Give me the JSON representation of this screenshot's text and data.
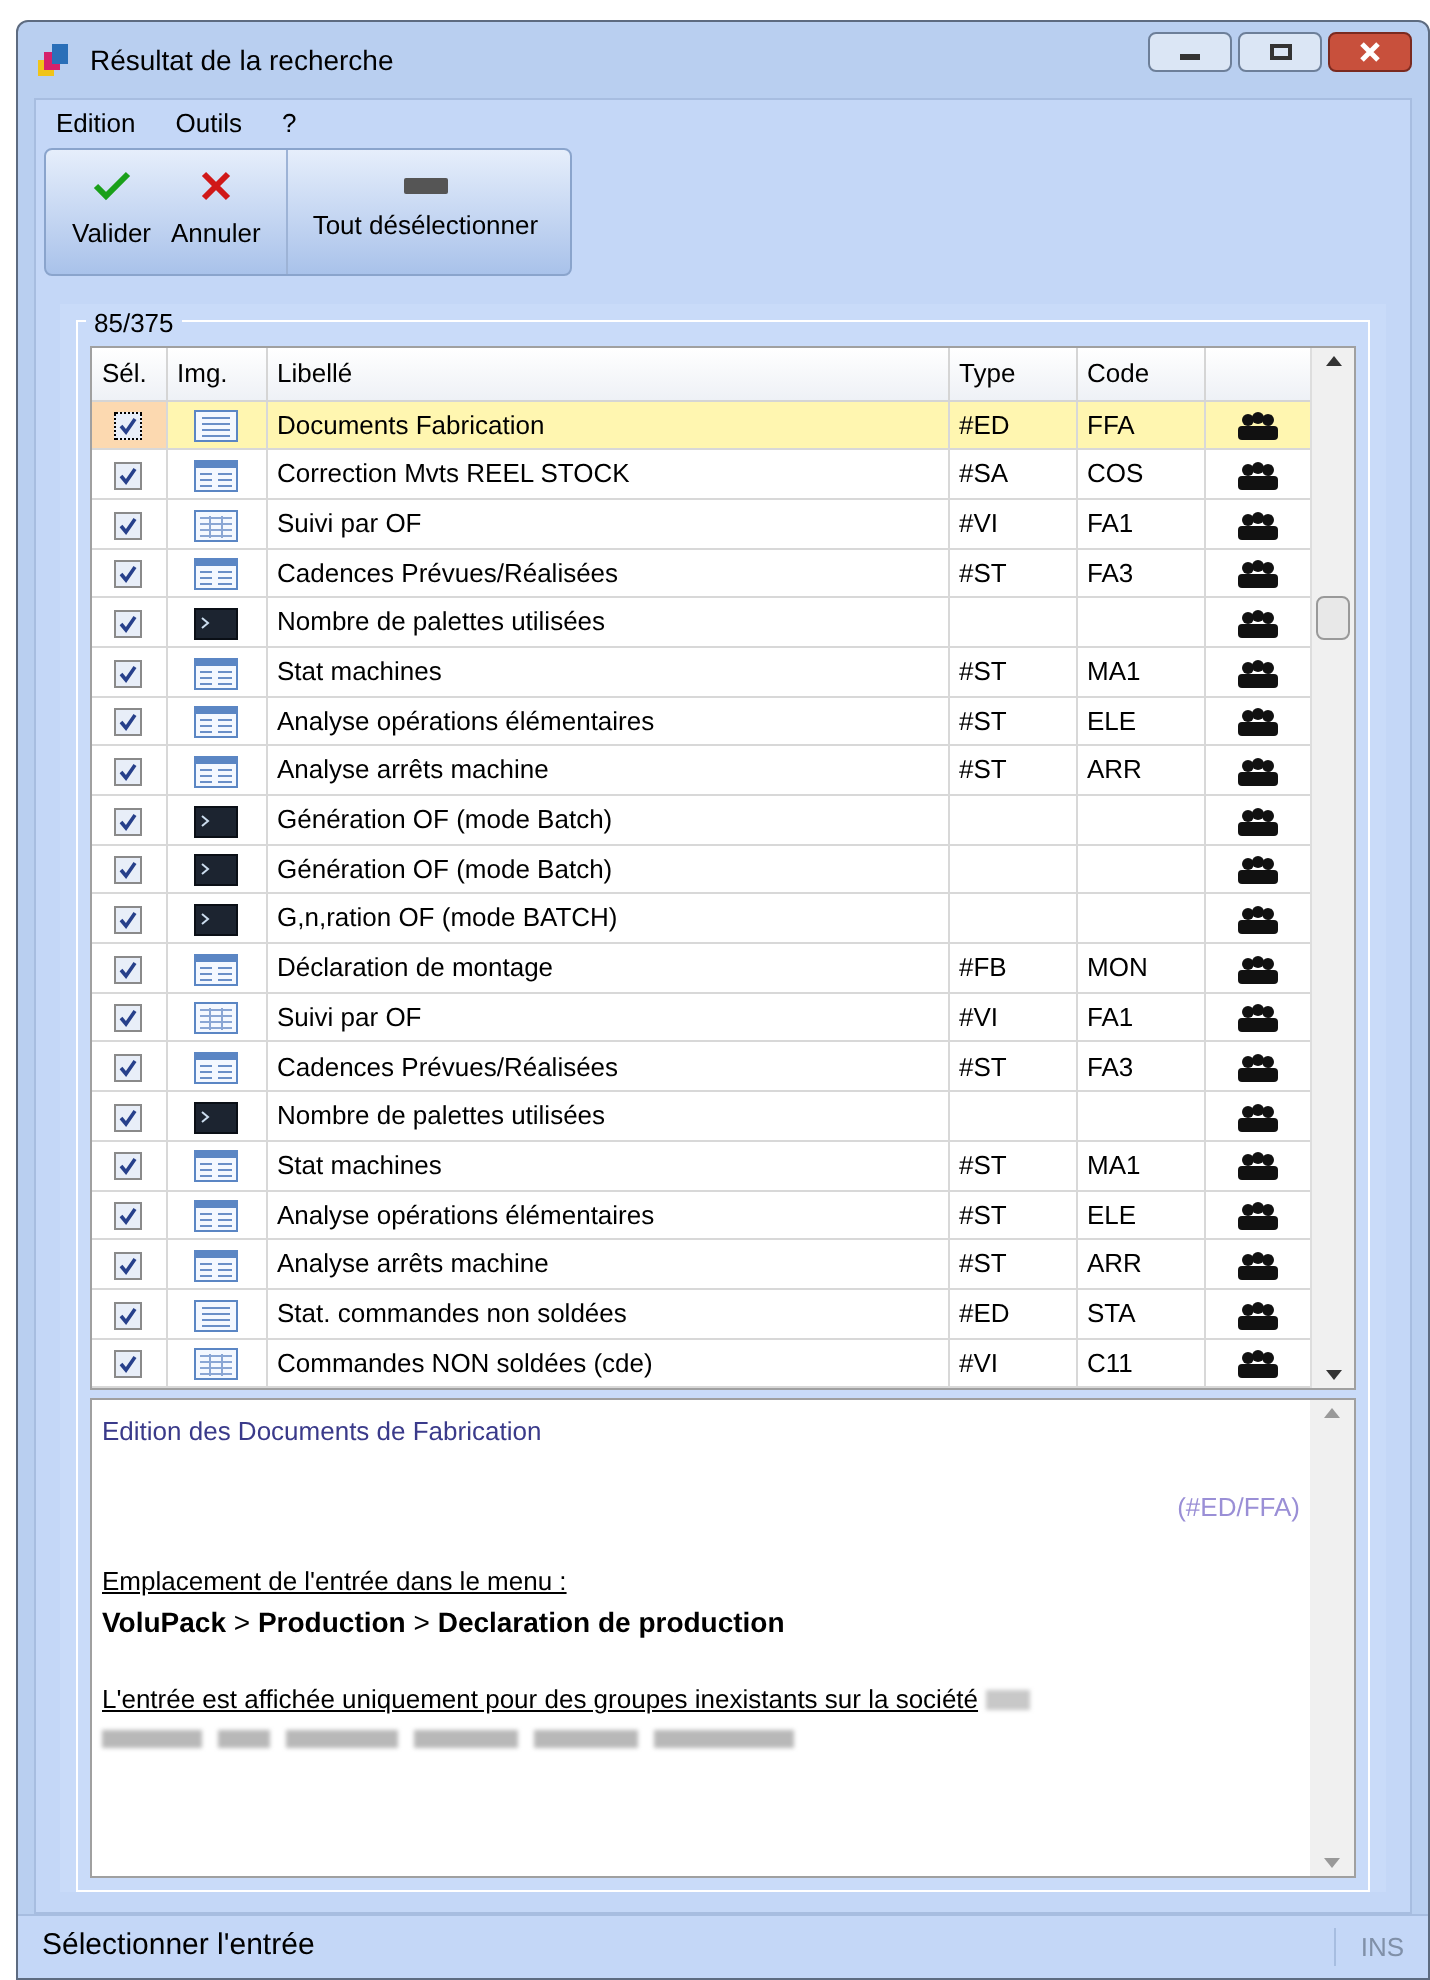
{
  "window": {
    "title": "Résultat de la recherche"
  },
  "menu": [
    "Edition",
    "Outils",
    "?"
  ],
  "toolbar": [
    {
      "kind": "check",
      "label": "Valider"
    },
    {
      "kind": "cross",
      "label": "Annuler"
    },
    {
      "kind": "dash",
      "label": "Tout désélectionner"
    }
  ],
  "group": {
    "title": "85/375"
  },
  "table": {
    "columns": [
      "Sél.",
      "Img.",
      "Libellé",
      "Type",
      "Code"
    ],
    "rows": [
      {
        "selected": true,
        "checked": true,
        "kind": "list",
        "label": "Documents Fabrication",
        "type": "#ED",
        "code": "FFA"
      },
      {
        "selected": false,
        "checked": true,
        "kind": "form",
        "label": "Correction Mvts REEL STOCK",
        "type": "#SA",
        "code": "COS"
      },
      {
        "selected": false,
        "checked": true,
        "kind": "grid",
        "label": "Suivi par OF",
        "type": "#VI",
        "code": "FA1"
      },
      {
        "selected": false,
        "checked": true,
        "kind": "form",
        "label": "Cadences Prévues/Réalisées",
        "type": "#ST",
        "code": "FA3"
      },
      {
        "selected": false,
        "checked": true,
        "kind": "console",
        "label": "Nombre de palettes utilisées"
      },
      {
        "selected": false,
        "checked": true,
        "kind": "form",
        "label": "Stat machines",
        "type": "#ST",
        "code": "MA1"
      },
      {
        "selected": false,
        "checked": true,
        "kind": "form",
        "label": "Analyse opérations élémentaires",
        "type": "#ST",
        "code": "ELE"
      },
      {
        "selected": false,
        "checked": true,
        "kind": "form",
        "label": "Analyse arrêts machine",
        "type": "#ST",
        "code": "ARR"
      },
      {
        "selected": false,
        "checked": true,
        "kind": "console",
        "label": "Génération OF (mode Batch)"
      },
      {
        "selected": false,
        "checked": true,
        "kind": "console",
        "label": "Génération OF (mode Batch)"
      },
      {
        "selected": false,
        "checked": true,
        "kind": "console",
        "label": "G,n,ration OF (mode BATCH)"
      },
      {
        "selected": false,
        "checked": true,
        "kind": "form",
        "label": "Déclaration de montage",
        "type": "#FB",
        "code": "MON"
      },
      {
        "selected": false,
        "checked": true,
        "kind": "grid",
        "label": "Suivi par OF",
        "type": "#VI",
        "code": "FA1"
      },
      {
        "selected": false,
        "checked": true,
        "kind": "form",
        "label": "Cadences Prévues/Réalisées",
        "type": "#ST",
        "code": "FA3"
      },
      {
        "selected": false,
        "checked": true,
        "kind": "console",
        "label": "Nombre de palettes utilisées"
      },
      {
        "selected": false,
        "checked": true,
        "kind": "form",
        "label": "Stat machines",
        "type": "#ST",
        "code": "MA1"
      },
      {
        "selected": false,
        "checked": true,
        "kind": "form",
        "label": "Analyse opérations élémentaires",
        "type": "#ST",
        "code": "ELE"
      },
      {
        "selected": false,
        "checked": true,
        "kind": "form",
        "label": "Analyse arrêts machine",
        "type": "#ST",
        "code": "ARR"
      },
      {
        "selected": false,
        "checked": true,
        "kind": "list",
        "label": "Stat. commandes non soldées",
        "type": "#ED",
        "code": "STA"
      },
      {
        "selected": false,
        "checked": true,
        "kind": "grid",
        "label": "Commandes NON soldées (cde)",
        "type": "#VI",
        "code": "C11"
      }
    ]
  },
  "description": {
    "title": "Edition des Documents de Fabrication",
    "reference": "(#ED/FFA)",
    "location_label": "Emplacement de l'entrée dans le menu :",
    "location_path": "**VoluPack** > **Production** > **Declaration de production**",
    "groups_label": "L'entrée est affichée uniquement pour des groupes inexistants sur la société"
  },
  "status_bar": {
    "message": "Sélectionner l'entrée",
    "mode": "INS"
  }
}
